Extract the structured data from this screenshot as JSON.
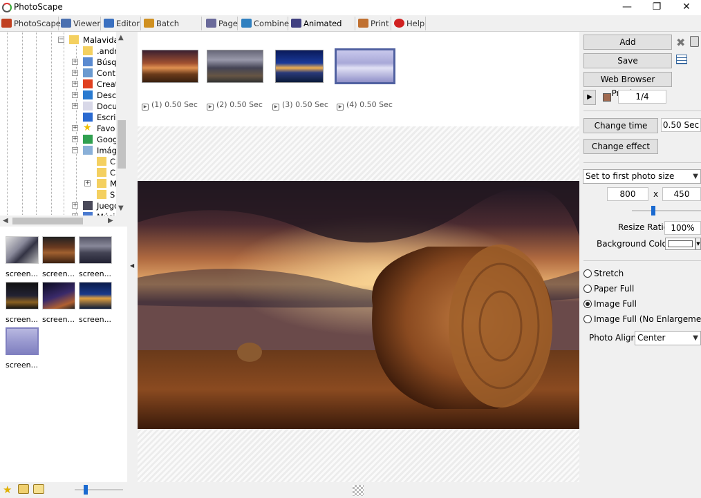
{
  "app": {
    "title": "PhotoScape"
  },
  "window": {
    "minimize": "—",
    "maximize": "❐",
    "close": "✕"
  },
  "menu": {
    "tabs": [
      {
        "label": "PhotoScape",
        "color": "#c04020"
      },
      {
        "label": "Viewer",
        "color": "#4a70b0"
      },
      {
        "label": "Editor",
        "color": "#3a70c0"
      },
      {
        "label": "Batch Editor",
        "color": "#d09020"
      },
      {
        "label": "Page",
        "color": "#6a6a9a"
      },
      {
        "label": "Combine",
        "color": "#3080c0"
      },
      {
        "label": "Animated GIF",
        "color": "#404080"
      },
      {
        "label": "Print",
        "color": "#c07030"
      },
      {
        "label": "Help",
        "color": "#d02020"
      }
    ]
  },
  "tree": {
    "items": [
      {
        "label": "Malavida",
        "icon": "folder-icon"
      },
      {
        "label": ".andr",
        "icon": "folder-icon"
      },
      {
        "label": "Búsq",
        "icon": "search-icon"
      },
      {
        "label": "Cont",
        "icon": "contacts-icon"
      },
      {
        "label": "Creat",
        "icon": "creative-cloud-icon"
      },
      {
        "label": "Desc",
        "icon": "download-icon"
      },
      {
        "label": "Docu",
        "icon": "document-icon"
      },
      {
        "label": "Escri",
        "icon": "desktop-icon"
      },
      {
        "label": "Favo",
        "icon": "star-icon"
      },
      {
        "label": "Goog",
        "icon": "google-drive-icon"
      },
      {
        "label": "Imág",
        "icon": "pictures-icon"
      },
      {
        "label": "C",
        "icon": "folder-icon"
      },
      {
        "label": "C",
        "icon": "folder-icon"
      },
      {
        "label": "M",
        "icon": "folder-icon"
      },
      {
        "label": "S",
        "icon": "folder-icon"
      },
      {
        "label": "Juego",
        "icon": "games-icon"
      },
      {
        "label": "Músi",
        "icon": "music-icon"
      }
    ]
  },
  "thumbnails": [
    {
      "caption": "screen..."
    },
    {
      "caption": "screen..."
    },
    {
      "caption": "screen..."
    },
    {
      "caption": "screen..."
    },
    {
      "caption": "screen..."
    },
    {
      "caption": "screen..."
    },
    {
      "caption": "screen..."
    }
  ],
  "frames": [
    {
      "label": "(1) 0.50 Sec"
    },
    {
      "label": "(2) 0.50 Sec"
    },
    {
      "label": "(3) 0.50 Sec"
    },
    {
      "label": "(4) 0.50 Sec"
    }
  ],
  "panel": {
    "add": "Add",
    "save": "Save",
    "web_preview": "Web Browser Preview",
    "frame_counter": "1/4",
    "change_time": "Change time",
    "time_value": "0.50 Sec",
    "change_effect": "Change effect",
    "size_mode": "Set to first photo size",
    "width": "800",
    "times": "x",
    "height": "450",
    "resize_ratio_label": "Resize Ratio",
    "resize_ratio": "100%",
    "bg_color_label": "Background Color",
    "bg_color": "#ffffff",
    "radios": [
      {
        "label": "Stretch",
        "checked": false
      },
      {
        "label": "Paper Full",
        "checked": false
      },
      {
        "label": "Image Full",
        "checked": true
      },
      {
        "label": "Image Full (No Enlargement)",
        "checked": false
      }
    ],
    "photo_align_label": "Photo Align",
    "photo_align": "Center"
  }
}
